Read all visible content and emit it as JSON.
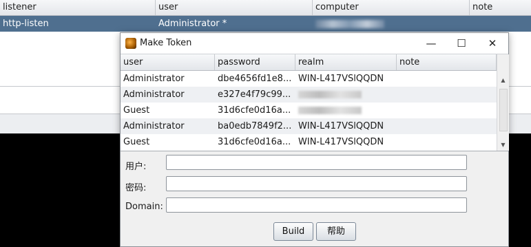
{
  "background_table": {
    "columns": [
      "listener",
      "user",
      "computer",
      "note"
    ],
    "selected_row": {
      "listener": "http-listen",
      "user": "Administrator *",
      "computer": "",
      "note": ""
    }
  },
  "dialog": {
    "title": "Make Token",
    "controls": {
      "minimize": "—",
      "maximize": "☐",
      "close": "✕"
    },
    "table": {
      "columns": [
        "user",
        "password",
        "realm",
        "note"
      ],
      "rows": [
        {
          "user": "Administrator",
          "password": "dbe4656fd1e8...",
          "realm": "WIN-L417VSlQQDN",
          "note": ""
        },
        {
          "user": "Administrator",
          "password": "e327e4f79c99...",
          "realm": "",
          "note": ""
        },
        {
          "user": "Guest",
          "password": "31d6cfe0d16a...",
          "realm": "",
          "note": ""
        },
        {
          "user": "Administrator",
          "password": "ba0edb7849f2...",
          "realm": "WIN-L417VSlQQDN",
          "note": ""
        },
        {
          "user": "Guest",
          "password": "31d6cfe0d16a...",
          "realm": "WIN-L417VSlQQDN",
          "note": ""
        }
      ]
    },
    "form": {
      "user_label": "用户:",
      "password_label": "密码:",
      "domain_label": "Domain:",
      "user_value": "",
      "password_value": "",
      "domain_value": ""
    },
    "buttons": {
      "build": "Build",
      "help": "帮助"
    }
  }
}
